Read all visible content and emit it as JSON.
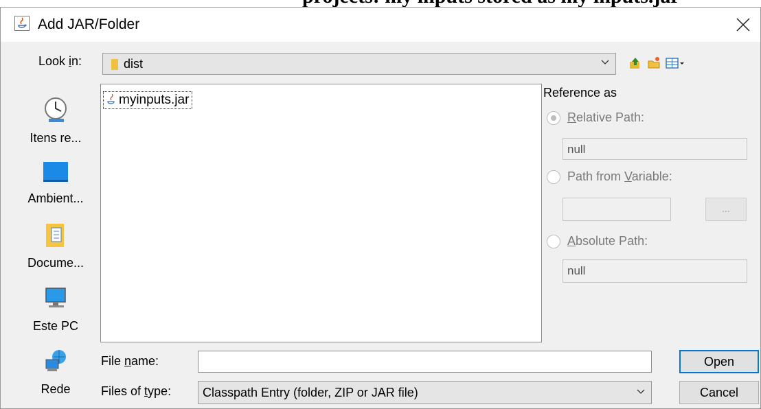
{
  "background_text": "projects: my inputs stored as my inputs.jar",
  "window": {
    "title": "Add JAR/Folder"
  },
  "toolbar": {
    "look_in_label_pre": "Look ",
    "look_in_label_mnemonic": "i",
    "look_in_label_post": "n:",
    "look_in_value": "dist"
  },
  "places": [
    {
      "label": "Itens re...",
      "icon": "recent-items-icon"
    },
    {
      "label": "Ambient...",
      "icon": "desktop-icon"
    },
    {
      "label": "Docume...",
      "icon": "documents-icon"
    },
    {
      "label": "Este PC",
      "icon": "computer-icon"
    },
    {
      "label": "Rede",
      "icon": "network-icon"
    }
  ],
  "files": [
    {
      "name": "myinputs.jar",
      "icon": "jar-file-icon"
    }
  ],
  "reference": {
    "title": "Reference as",
    "relative_mn": "R",
    "relative_rest": "elative Path:",
    "relative_value": "null",
    "variable_pre": "Path from ",
    "variable_mn": "V",
    "variable_rest": "ariable:",
    "variable_value": "",
    "browse_label": "...",
    "absolute_mn": "A",
    "absolute_rest": "bsolute Path:",
    "absolute_value": "null",
    "selected": "relative"
  },
  "bottom": {
    "file_name_pre": "File ",
    "file_name_mn": "n",
    "file_name_post": "ame:",
    "file_name_value": "",
    "files_of_type_pre": "Files of ",
    "files_of_type_mn": "t",
    "files_of_type_post": "ype:",
    "files_of_type_value": "Classpath Entry (folder, ZIP or JAR file)",
    "open_label": "Open",
    "cancel_label": "Cancel"
  },
  "colors": {
    "accent": "#0078d7",
    "dialog_bg": "#f0f0f0",
    "disabled_text": "#7a7a7a"
  }
}
